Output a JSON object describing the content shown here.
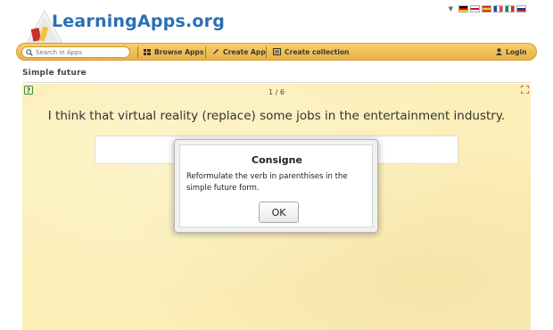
{
  "header": {
    "logo_text": "LearningApps.org",
    "languages": [
      "German",
      "English",
      "Spanish",
      "French",
      "Italian",
      "Russian"
    ]
  },
  "nav": {
    "search_placeholder": "Search in Apps",
    "browse_label": "Browse Apps",
    "create_label": "Create App",
    "collection_label": "Create collection",
    "login_label": "Login"
  },
  "page": {
    "title": "Simple future"
  },
  "app": {
    "counter": "1 / 6",
    "question": "I think that virtual reality (replace) some jobs in the entertainment industry.",
    "answer_value": ""
  },
  "dialog": {
    "title": "Consigne",
    "text": "Reformulate the verb in parenthises in the simple future form.",
    "ok_label": "OK"
  },
  "colors": {
    "navbar": "#e8b24a",
    "app_background": "#fcefb8",
    "logo_text": "#2a6fb4"
  }
}
